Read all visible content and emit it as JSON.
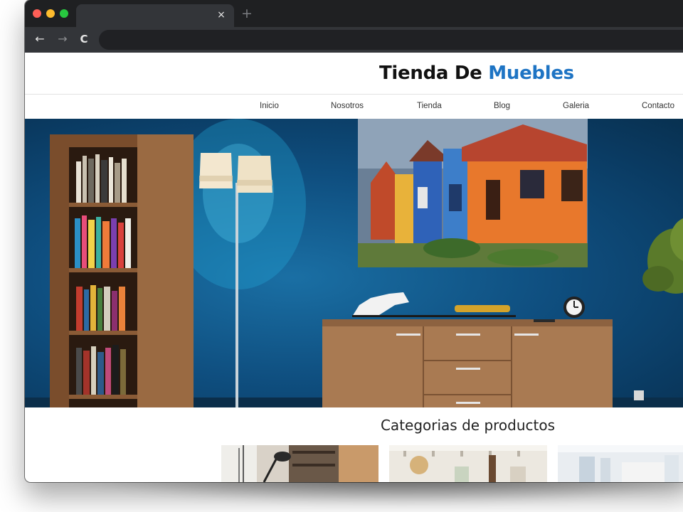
{
  "browser": {
    "tab_close_icon": "close-icon",
    "new_tab_icon": "plus-icon",
    "back_icon": "arrow-left-icon",
    "forward_icon": "arrow-right-icon",
    "reload_icon": "reload-icon",
    "tab_close_glyph": "×",
    "new_tab_glyph": "+",
    "back_glyph": "←",
    "forward_glyph": "→",
    "reload_glyph": "C"
  },
  "site": {
    "title_part1": "Tienda De ",
    "title_part2": "Muebles",
    "accent_color": "#1e74c4"
  },
  "nav": {
    "items": [
      {
        "label": "Inicio"
      },
      {
        "label": "Nosotros"
      },
      {
        "label": "Tienda"
      },
      {
        "label": "Blog"
      },
      {
        "label": "Galeria"
      },
      {
        "label": "Contacto"
      }
    ]
  },
  "hero": {
    "wall_color": "#0f4f80"
  },
  "categories": {
    "title": "Categorias de productos"
  }
}
